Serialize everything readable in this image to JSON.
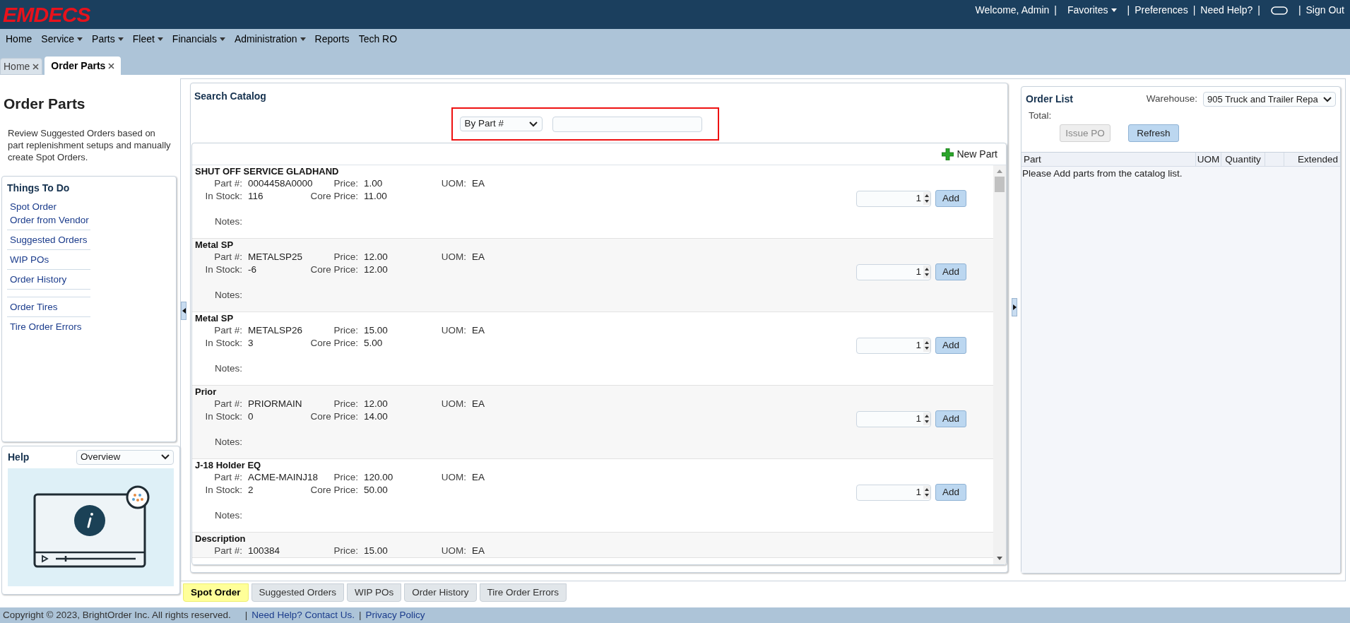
{
  "header": {
    "logo": "EMDECS",
    "links": [
      {
        "kind": "text",
        "label": "Welcome, Admin"
      },
      {
        "kind": "sep",
        "label": "|"
      },
      {
        "kind": "menu",
        "label": "Favorites"
      },
      {
        "kind": "sep",
        "label": "|"
      },
      {
        "kind": "link",
        "label": "Preferences"
      },
      {
        "kind": "sep",
        "label": "|"
      },
      {
        "kind": "link",
        "label": "Need Help?"
      },
      {
        "kind": "sep",
        "label": "|"
      },
      {
        "kind": "icon"
      },
      {
        "kind": "sep",
        "label": "|"
      },
      {
        "kind": "link",
        "label": "Sign Out"
      }
    ]
  },
  "menu": [
    {
      "label": "Home",
      "has_menu": false
    },
    {
      "label": "Service",
      "has_menu": true
    },
    {
      "label": "Parts",
      "has_menu": true
    },
    {
      "label": "Fleet",
      "has_menu": true
    },
    {
      "label": "Financials",
      "has_menu": true
    },
    {
      "label": "Administration",
      "has_menu": true
    },
    {
      "label": "Reports",
      "has_menu": false
    },
    {
      "label": "Tech RO",
      "has_menu": false
    }
  ],
  "page_tabs": [
    {
      "label": "Home",
      "selected": false
    },
    {
      "label": "Order Parts",
      "selected": true
    }
  ],
  "sidebar": {
    "title": "Order Parts",
    "description": "Review Suggested Orders based on part replenishment setups and manually create Spot Orders.",
    "todo_title": "Things To Do",
    "groups": [
      [
        "Spot Order",
        "Order from Vendor"
      ],
      [
        "Suggested Orders"
      ],
      [
        "WIP POs"
      ],
      [
        "Order History"
      ],
      [
        "Order Tires"
      ],
      [
        "Tire Order Errors"
      ]
    ],
    "help_title": "Help",
    "help_select": "Overview"
  },
  "catalog": {
    "title": "Search Catalog",
    "search_by": "By Part #",
    "new_part": "New Part",
    "items": [
      {
        "name": "SHUT OFF SERVICE GLADHAND",
        "part_label": "Part #:",
        "part": "0004458A0000",
        "price_label": "Price:",
        "price": "1.00",
        "uom_label": "UOM:",
        "uom": "EA",
        "stock_label": "In Stock:",
        "stock": "116",
        "core_label": "Core Price:",
        "core": "11.00",
        "notes_label": "Notes:",
        "qty": "1",
        "add": "Add"
      },
      {
        "name": "Metal SP",
        "part_label": "Part #:",
        "part": "METALSP25",
        "price_label": "Price:",
        "price": "12.00",
        "uom_label": "UOM:",
        "uom": "EA",
        "stock_label": "In Stock:",
        "stock": "-6",
        "core_label": "Core Price:",
        "core": "12.00",
        "notes_label": "Notes:",
        "qty": "1",
        "add": "Add"
      },
      {
        "name": "Metal SP",
        "part_label": "Part #:",
        "part": "METALSP26",
        "price_label": "Price:",
        "price": "15.00",
        "uom_label": "UOM:",
        "uom": "EA",
        "stock_label": "In Stock:",
        "stock": "3",
        "core_label": "Core Price:",
        "core": "5.00",
        "notes_label": "Notes:",
        "qty": "1",
        "add": "Add"
      },
      {
        "name": "Prior",
        "part_label": "Part #:",
        "part": "PRIORMAIN",
        "price_label": "Price:",
        "price": "12.00",
        "uom_label": "UOM:",
        "uom": "EA",
        "stock_label": "In Stock:",
        "stock": "0",
        "core_label": "Core Price:",
        "core": "14.00",
        "notes_label": "Notes:",
        "qty": "1",
        "add": "Add"
      },
      {
        "name": "J-18 Holder EQ",
        "part_label": "Part #:",
        "part": "ACME-MAINJ18",
        "price_label": "Price:",
        "price": "120.00",
        "uom_label": "UOM:",
        "uom": "EA",
        "stock_label": "In Stock:",
        "stock": "2",
        "core_label": "Core Price:",
        "core": "50.00",
        "notes_label": "Notes:",
        "qty": "1",
        "add": "Add"
      },
      {
        "name": "Description",
        "part_label": "Part #:",
        "part": "100384",
        "price_label": "Price:",
        "price": "15.00",
        "uom_label": "UOM:",
        "uom": "EA"
      }
    ]
  },
  "order_list": {
    "title": "Order List",
    "warehouse_label": "Warehouse:",
    "warehouse": "905 Truck and Trailer Repa",
    "total_label": "Total:",
    "buttons": [
      {
        "label": "Issue PO",
        "disabled": true
      },
      {
        "label": "Refresh",
        "disabled": false
      }
    ],
    "columns": [
      "Part",
      "UOM",
      "Quantity",
      "Extended"
    ],
    "empty": "Please Add parts from the catalog list."
  },
  "bottom_tabs": [
    {
      "label": "Spot Order",
      "selected": true
    },
    {
      "label": "Suggested Orders",
      "selected": false
    },
    {
      "label": "WIP POs",
      "selected": false
    },
    {
      "label": "Order History",
      "selected": false
    },
    {
      "label": "Tire Order Errors",
      "selected": false
    }
  ],
  "footer": {
    "copyright": "Copyright © 2023, BrightOrder Inc. All rights reserved.",
    "links": [
      {
        "sep": "|",
        "label": "Need Help? Contact Us."
      },
      {
        "sep": "|",
        "label": "Privacy Policy"
      }
    ]
  }
}
